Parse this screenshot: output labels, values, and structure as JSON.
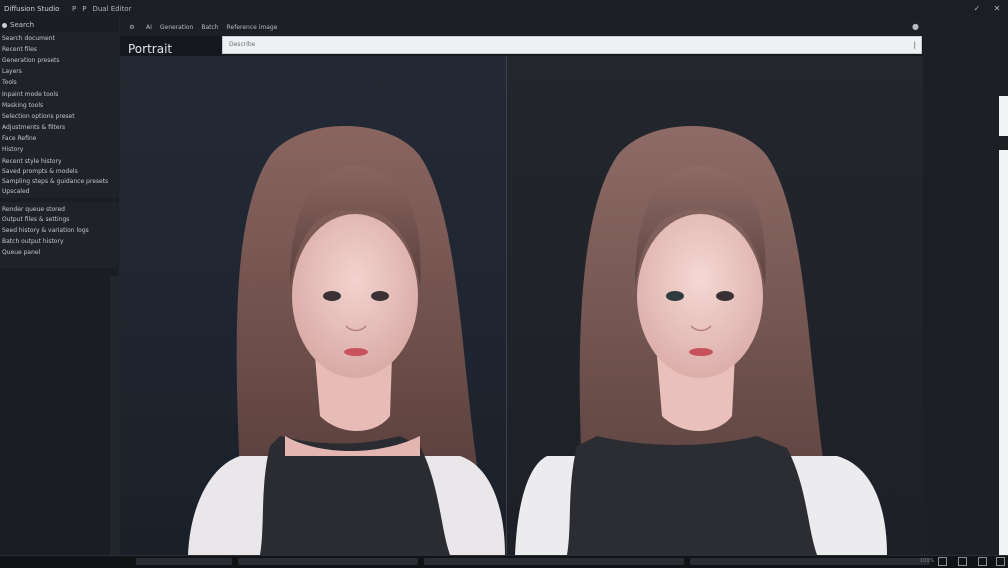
{
  "window": {
    "app_title": "Diffusion Studio",
    "menu_1": "P",
    "menu_2": "P",
    "menu_3": "Dual Editor"
  },
  "toolbar": {
    "item_1": "AI",
    "item_2": "Generation",
    "item_3": "Batch",
    "item_4": "Reference image"
  },
  "sidebar": {
    "header": "Search",
    "items": [
      "Search document",
      "Recent files",
      "Generation presets",
      "Layers",
      "Tools",
      "Inpaint mode tools",
      "Masking tools",
      "Selection options preset",
      "Adjustments & filters",
      "Face Refine",
      "History"
    ],
    "section2": [
      "Recent style history",
      "Saved prompts & models",
      "Sampling steps & guidance presets",
      "Upscaled"
    ],
    "section3": [
      "Render queue stored",
      "Output files & settings",
      "Seed history & variation logs",
      "Batch output history",
      "Queue panel"
    ]
  },
  "main": {
    "tool_title": "Portrait",
    "prompt_placeholder": "Describe"
  },
  "status": {
    "zoom": "100%"
  },
  "colors": {
    "bg": "#15181d",
    "panel": "#1a1d22",
    "accent": "#eef0f3"
  }
}
